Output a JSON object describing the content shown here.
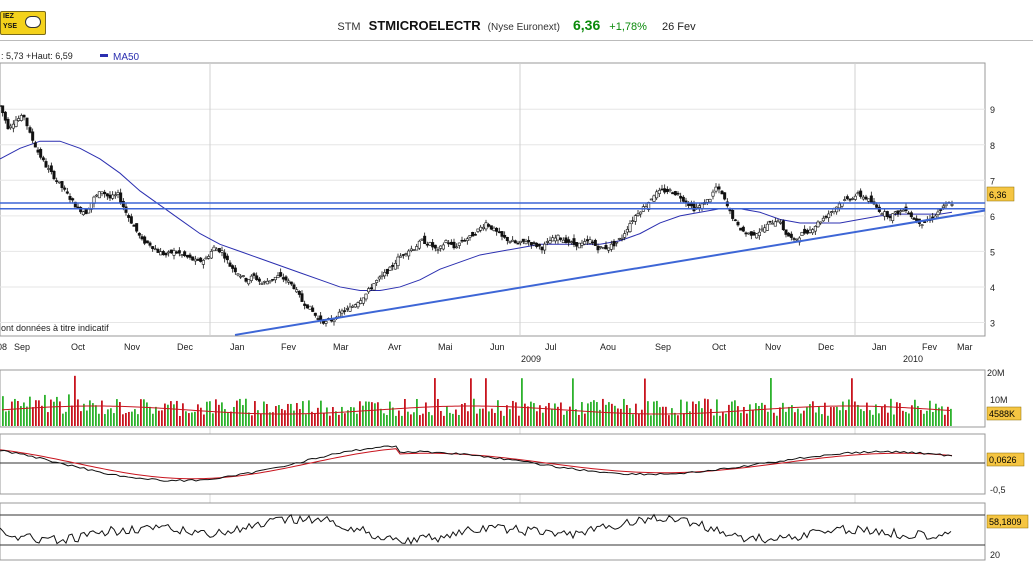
{
  "header": {
    "logo_line1": "IEZ",
    "logo_line2": "YSE",
    "ticker": "STM",
    "name": "STMICROELECTR",
    "exchange": "(Nyse Euronext)",
    "price": "6,36",
    "change": "+1,78%",
    "date": "26 Fev"
  },
  "colors": {
    "up": "#2db22d",
    "down": "#c8141e",
    "ma": "#2b2fb0",
    "trend": "#3d66d6",
    "price_box": "#f5c542"
  },
  "chart_data": {
    "type": "line",
    "price_panel": {
      "legend_text": ": 5,73 +Haut: 6,59",
      "legend_ma_label": "MA50",
      "note": "ont données à titre indicatif",
      "ylim": [
        2.62,
        10.3
      ],
      "ytick_labels": [
        "3",
        "4",
        "5",
        "6",
        "7",
        "8",
        "9"
      ],
      "last_label": "6,36",
      "x_month_labels": [
        "08",
        "Sep",
        "Oct",
        "Nov",
        "Dec",
        "Jan",
        "Fev",
        "Mar",
        "Avr",
        "Mai",
        "Jun",
        "Jul",
        "Aou",
        "Sep",
        "Oct",
        "Nov",
        "Dec",
        "Jan",
        "Fev",
        "Mar"
      ],
      "x_year_labels": [
        "2009",
        "2010"
      ],
      "series": [
        {
          "name": "Close",
          "points": [
            [
              0,
              9.1
            ],
            [
              8,
              8.5
            ],
            [
              16,
              8.7
            ],
            [
              24,
              8.8
            ],
            [
              30,
              8.3
            ],
            [
              38,
              7.8
            ],
            [
              46,
              7.4
            ],
            [
              54,
              7.1
            ],
            [
              62,
              6.8
            ],
            [
              70,
              6.5
            ],
            [
              78,
              6.2
            ],
            [
              86,
              6.1
            ],
            [
              94,
              6.5
            ],
            [
              102,
              6.7
            ],
            [
              110,
              6.5
            ],
            [
              118,
              6.6
            ],
            [
              126,
              6.1
            ],
            [
              134,
              5.7
            ],
            [
              142,
              5.3
            ],
            [
              150,
              5.2
            ],
            [
              158,
              5.0
            ],
            [
              166,
              4.9
            ],
            [
              174,
              5.0
            ],
            [
              182,
              4.9
            ],
            [
              190,
              4.8
            ],
            [
              198,
              4.7
            ],
            [
              206,
              4.8
            ],
            [
              214,
              5.1
            ],
            [
              222,
              5.0
            ],
            [
              230,
              4.6
            ],
            [
              238,
              4.4
            ],
            [
              246,
              4.2
            ],
            [
              254,
              4.3
            ],
            [
              262,
              4.1
            ],
            [
              270,
              4.2
            ],
            [
              278,
              4.3
            ],
            [
              286,
              4.2
            ],
            [
              294,
              4.0
            ],
            [
              302,
              3.6
            ],
            [
              310,
              3.4
            ],
            [
              318,
              3.1
            ],
            [
              326,
              3.0
            ],
            [
              334,
              3.1
            ],
            [
              342,
              3.3
            ],
            [
              350,
              3.4
            ],
            [
              358,
              3.6
            ],
            [
              366,
              3.8
            ],
            [
              374,
              4.1
            ],
            [
              382,
              4.3
            ],
            [
              390,
              4.5
            ],
            [
              398,
              4.8
            ],
            [
              406,
              5.0
            ],
            [
              414,
              5.1
            ],
            [
              422,
              5.3
            ],
            [
              430,
              5.2
            ],
            [
              438,
              5.0
            ],
            [
              446,
              5.3
            ],
            [
              454,
              5.1
            ],
            [
              462,
              5.3
            ],
            [
              470,
              5.4
            ],
            [
              478,
              5.6
            ],
            [
              486,
              5.8
            ],
            [
              494,
              5.6
            ],
            [
              502,
              5.4
            ],
            [
              510,
              5.3
            ],
            [
              518,
              5.2
            ],
            [
              526,
              5.3
            ],
            [
              534,
              5.2
            ],
            [
              542,
              5.1
            ],
            [
              550,
              5.3
            ],
            [
              558,
              5.4
            ],
            [
              566,
              5.3
            ],
            [
              574,
              5.2
            ],
            [
              582,
              5.2
            ],
            [
              590,
              5.3
            ],
            [
              598,
              5.1
            ],
            [
              606,
              5.1
            ],
            [
              614,
              5.2
            ],
            [
              622,
              5.4
            ],
            [
              630,
              5.8
            ],
            [
              638,
              6.1
            ],
            [
              646,
              6.3
            ],
            [
              654,
              6.6
            ],
            [
              662,
              6.7
            ],
            [
              670,
              6.7
            ],
            [
              678,
              6.6
            ],
            [
              686,
              6.4
            ],
            [
              694,
              6.2
            ],
            [
              702,
              6.3
            ],
            [
              710,
              6.5
            ],
            [
              716,
              6.8
            ],
            [
              722,
              6.6
            ],
            [
              730,
              6.1
            ],
            [
              738,
              5.7
            ],
            [
              746,
              5.5
            ],
            [
              754,
              5.5
            ],
            [
              762,
              5.6
            ],
            [
              770,
              5.8
            ],
            [
              778,
              5.9
            ],
            [
              786,
              5.5
            ],
            [
              794,
              5.3
            ],
            [
              802,
              5.5
            ],
            [
              810,
              5.6
            ],
            [
              818,
              5.8
            ],
            [
              826,
              6.0
            ],
            [
              834,
              6.2
            ],
            [
              842,
              6.4
            ],
            [
              850,
              6.5
            ],
            [
              858,
              6.6
            ],
            [
              866,
              6.5
            ],
            [
              874,
              6.3
            ],
            [
              882,
              6.1
            ],
            [
              890,
              6.0
            ],
            [
              898,
              6.1
            ],
            [
              906,
              6.2
            ],
            [
              914,
              5.9
            ],
            [
              922,
              5.8
            ],
            [
              930,
              5.9
            ],
            [
              938,
              6.1
            ],
            [
              946,
              6.3
            ],
            [
              952,
              6.36
            ]
          ]
        },
        {
          "name": "MA50",
          "points": [
            [
              0,
              7.6
            ],
            [
              20,
              7.9
            ],
            [
              40,
              8.1
            ],
            [
              60,
              8.1
            ],
            [
              80,
              7.9
            ],
            [
              100,
              7.6
            ],
            [
              120,
              7.2
            ],
            [
              140,
              6.7
            ],
            [
              160,
              6.3
            ],
            [
              180,
              5.9
            ],
            [
              200,
              5.5
            ],
            [
              220,
              5.2
            ],
            [
              240,
              5.0
            ],
            [
              260,
              4.8
            ],
            [
              280,
              4.6
            ],
            [
              300,
              4.4
            ],
            [
              320,
              4.2
            ],
            [
              340,
              4.0
            ],
            [
              360,
              3.9
            ],
            [
              380,
              3.9
            ],
            [
              400,
              4.0
            ],
            [
              420,
              4.2
            ],
            [
              440,
              4.5
            ],
            [
              460,
              4.7
            ],
            [
              480,
              4.9
            ],
            [
              500,
              5.0
            ],
            [
              520,
              5.1
            ],
            [
              540,
              5.2
            ],
            [
              560,
              5.2
            ],
            [
              580,
              5.2
            ],
            [
              600,
              5.2
            ],
            [
              620,
              5.3
            ],
            [
              640,
              5.5
            ],
            [
              660,
              5.8
            ],
            [
              680,
              6.0
            ],
            [
              700,
              6.1
            ],
            [
              720,
              6.2
            ],
            [
              740,
              6.2
            ],
            [
              760,
              6.1
            ],
            [
              780,
              5.9
            ],
            [
              800,
              5.8
            ],
            [
              820,
              5.8
            ],
            [
              840,
              5.8
            ],
            [
              860,
              5.9
            ],
            [
              880,
              6.0
            ],
            [
              900,
              6.05
            ],
            [
              920,
              6.05
            ],
            [
              940,
              6.05
            ],
            [
              952,
              6.1
            ]
          ]
        }
      ],
      "horizontal_lines": [
        6.36,
        6.2
      ],
      "trendline": {
        "from": [
          235,
          2.65
        ],
        "to": [
          985,
          6.15
        ]
      }
    },
    "volume_panel": {
      "ytick_labels": [
        "20M",
        "10M"
      ],
      "last_label": "4588K",
      "note": "volume bars colored green/red, red moving-average line overlay"
    },
    "macd_panel": {
      "ytick_labels": [
        "-0,5"
      ],
      "last_label": "0,0626"
    },
    "rsi_panel": {
      "ytick_labels": [
        "20"
      ],
      "last_label": "58,1809"
    }
  }
}
